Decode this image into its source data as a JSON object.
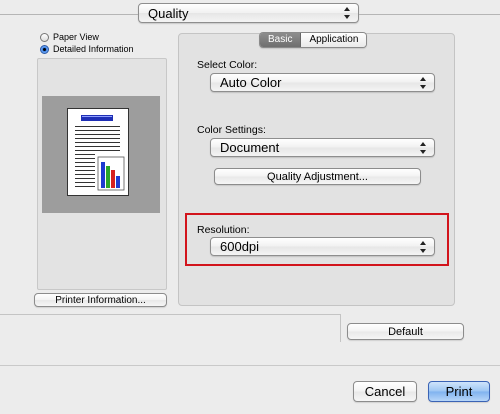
{
  "top": {
    "quality_popup": "Quality"
  },
  "view": {
    "paper_view": "Paper View",
    "detailed_information": "Detailed Information",
    "selected": "detailed_information"
  },
  "printer_info_button": "Printer Information...",
  "tabs": [
    {
      "label": "Basic",
      "active": true
    },
    {
      "label": "Application",
      "active": false
    }
  ],
  "select_color": {
    "label": "Select Color:",
    "value": "Auto Color"
  },
  "color_settings": {
    "label": "Color Settings:",
    "value": "Document"
  },
  "quality_adjustment_button": "Quality Adjustment...",
  "resolution": {
    "label": "Resolution:",
    "value": "600dpi"
  },
  "highlight_color": "#d2141c",
  "default_button": "Default",
  "cancel_button": "Cancel",
  "print_button": "Print"
}
